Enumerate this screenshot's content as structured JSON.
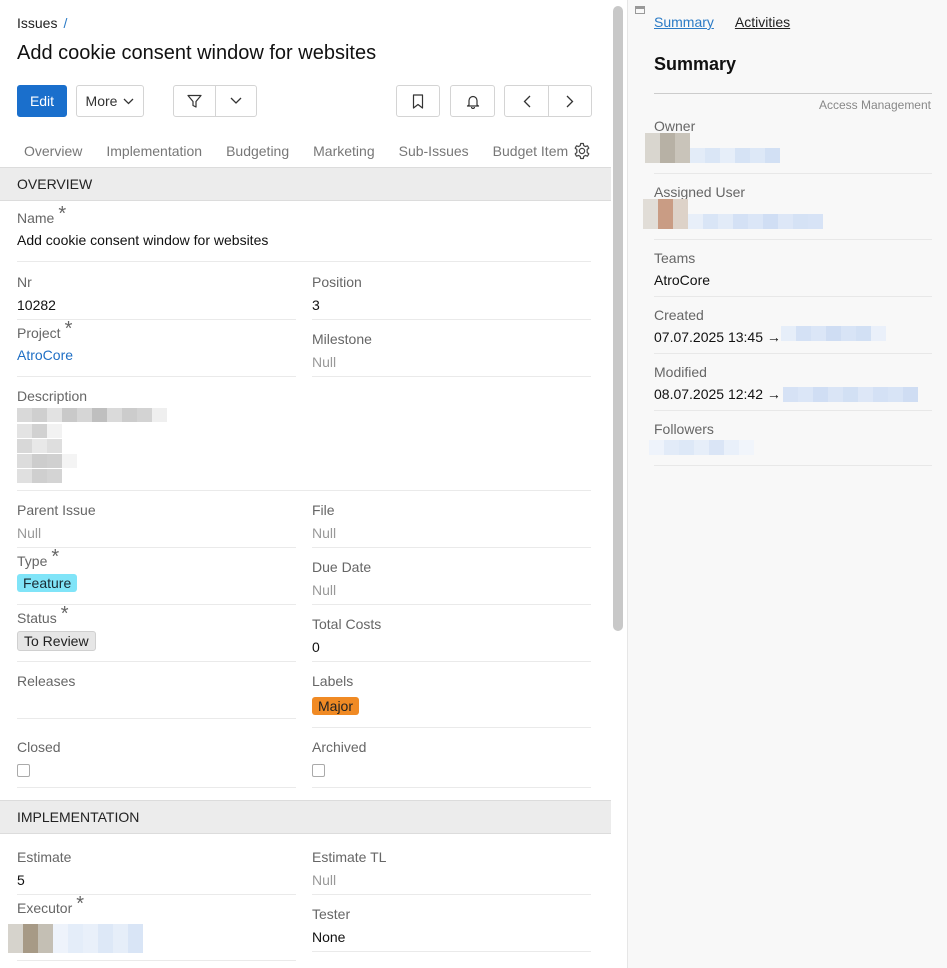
{
  "breadcrumb": {
    "parent": "Issues",
    "separator": "/"
  },
  "title": "Add cookie consent window for websites",
  "toolbar": {
    "edit_label": "Edit",
    "more_label": "More"
  },
  "tabs": [
    "Overview",
    "Implementation",
    "Budgeting",
    "Marketing",
    "Sub-Issues",
    "Budget Item"
  ],
  "sections": {
    "overview": "OVERVIEW",
    "implementation": "IMPLEMENTATION"
  },
  "overview": {
    "name": {
      "label": "Name",
      "value": "Add cookie consent window for websites"
    },
    "nr": {
      "label": "Nr",
      "value": "10282"
    },
    "position": {
      "label": "Position",
      "value": "3"
    },
    "project": {
      "label": "Project",
      "value": "AtroCore"
    },
    "milestone": {
      "label": "Milestone",
      "value": "Null"
    },
    "description": {
      "label": "Description"
    },
    "parent_issue": {
      "label": "Parent Issue",
      "value": "Null"
    },
    "file": {
      "label": "File",
      "value": "Null"
    },
    "type": {
      "label": "Type",
      "value": "Feature"
    },
    "due_date": {
      "label": "Due Date",
      "value": "Null"
    },
    "status": {
      "label": "Status",
      "value": "To Review"
    },
    "total_costs": {
      "label": "Total Costs",
      "value": "0"
    },
    "releases": {
      "label": "Releases"
    },
    "labels": {
      "label": "Labels",
      "value": "Major"
    },
    "closed": {
      "label": "Closed"
    },
    "archived": {
      "label": "Archived"
    }
  },
  "implementation": {
    "estimate": {
      "label": "Estimate",
      "value": "5"
    },
    "estimate_tl": {
      "label": "Estimate TL",
      "value": "Null"
    },
    "executor": {
      "label": "Executor"
    },
    "tester": {
      "label": "Tester",
      "value": "None"
    }
  },
  "side_panel": {
    "tab_summary": "Summary",
    "tab_activities": "Activities",
    "title": "Summary",
    "access_management": "Access Management",
    "owner_label": "Owner",
    "assigned_user_label": "Assigned User",
    "teams_label": "Teams",
    "teams_value": "AtroCore",
    "created_label": "Created",
    "created_value": "07.07.2025 13:45 →",
    "modified_label": "Modified",
    "modified_value": "08.07.2025 12:42 →",
    "followers_label": "Followers"
  },
  "colors": {
    "accent": "#1a6fcc",
    "link": "#1f6fc5",
    "feature_badge": "#80e4f8",
    "major_badge": "#f08a24"
  },
  "icons": [
    "filter-icon",
    "chevron-down-icon",
    "bookmark-icon",
    "bell-icon",
    "chevron-left-icon",
    "chevron-right-icon",
    "gear-icon"
  ]
}
